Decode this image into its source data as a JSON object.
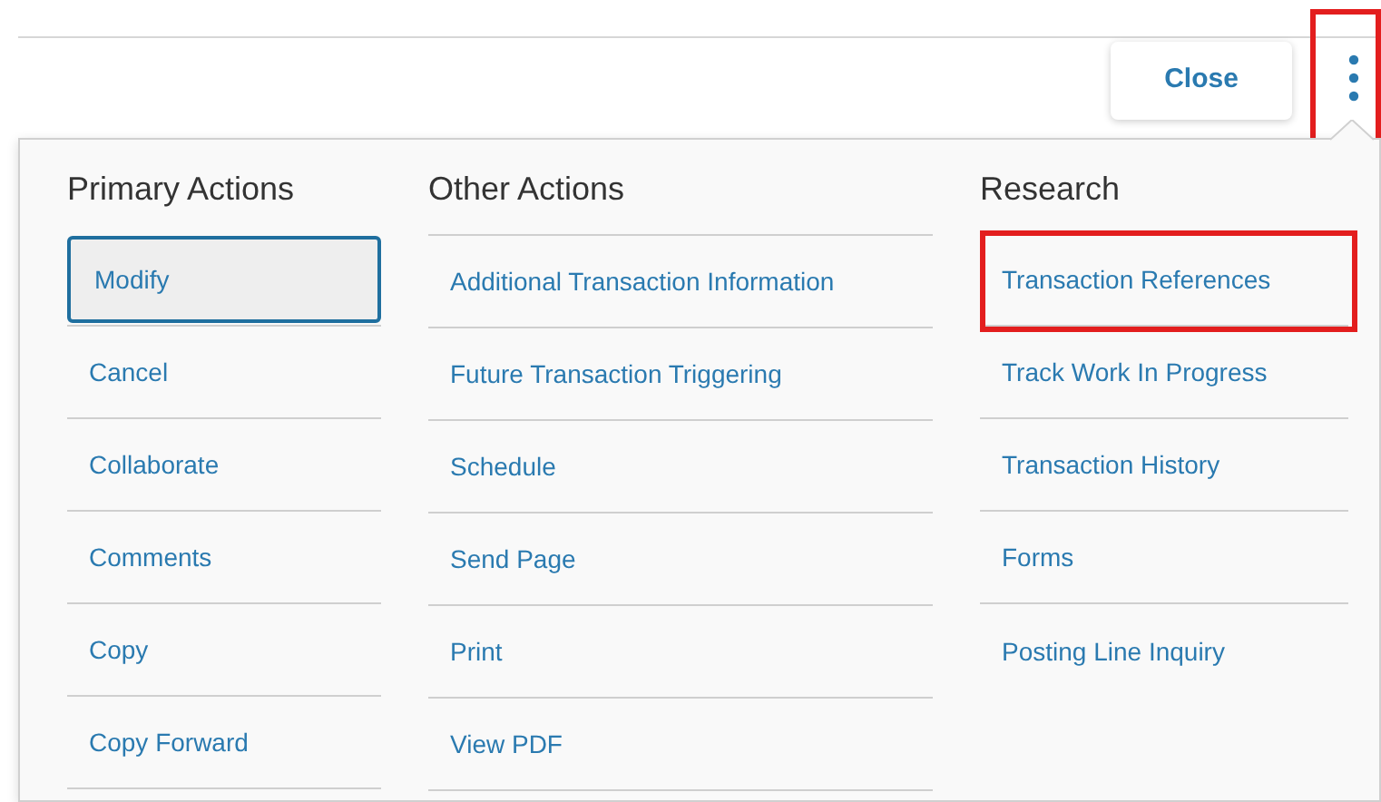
{
  "toolbar": {
    "close_button": "Close",
    "menu_button": {
      "highlighted": true
    }
  },
  "menu": {
    "columns": [
      {
        "heading": "Primary Actions",
        "items": [
          {
            "label": "Modify",
            "selected": true,
            "highlighted": false
          },
          {
            "label": "Cancel",
            "selected": false,
            "highlighted": false
          },
          {
            "label": "Collaborate",
            "selected": false,
            "highlighted": false
          },
          {
            "label": "Comments",
            "selected": false,
            "highlighted": false
          },
          {
            "label": "Copy",
            "selected": false,
            "highlighted": false
          },
          {
            "label": "Copy Forward",
            "selected": false,
            "highlighted": false
          }
        ]
      },
      {
        "heading": "Other Actions",
        "items": [
          {
            "label": "Additional Transaction Information",
            "selected": false,
            "highlighted": false
          },
          {
            "label": "Future Transaction Triggering",
            "selected": false,
            "highlighted": false
          },
          {
            "label": "Schedule",
            "selected": false,
            "highlighted": false
          },
          {
            "label": "Send Page",
            "selected": false,
            "highlighted": false
          },
          {
            "label": "Print",
            "selected": false,
            "highlighted": false
          },
          {
            "label": "View PDF",
            "selected": false,
            "highlighted": false
          }
        ]
      },
      {
        "heading": "Research",
        "items": [
          {
            "label": "Transaction References",
            "selected": false,
            "highlighted": true
          },
          {
            "label": "Track Work In Progress",
            "selected": false,
            "highlighted": false
          },
          {
            "label": "Transaction History",
            "selected": false,
            "highlighted": false
          },
          {
            "label": "Forms",
            "selected": false,
            "highlighted": false
          },
          {
            "label": "Posting Line Inquiry",
            "selected": false,
            "highlighted": false
          }
        ]
      }
    ]
  }
}
